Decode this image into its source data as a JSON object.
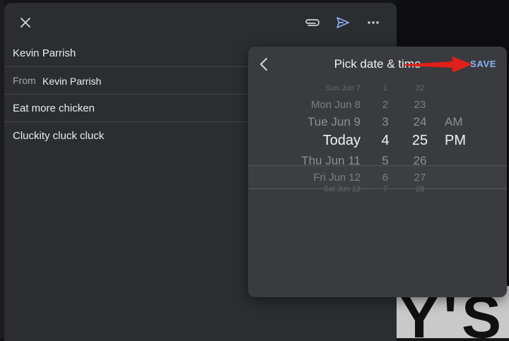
{
  "compose": {
    "to": "Kevin Parrish",
    "from_label": "From",
    "from_value": "Kevin Parrish",
    "subject": "Eat more chicken",
    "body": "Cluckity cluck cluck"
  },
  "picker": {
    "title": "Pick date & time",
    "save_label": "SAVE",
    "rows": [
      {
        "day": "Sun Jun 7",
        "hour": "1",
        "minute": "22",
        "ampm": ""
      },
      {
        "day": "Mon Jun 8",
        "hour": "2",
        "minute": "23",
        "ampm": ""
      },
      {
        "day": "Tue Jun 9",
        "hour": "3",
        "minute": "24",
        "ampm": "AM"
      },
      {
        "day": "Today",
        "hour": "4",
        "minute": "25",
        "ampm": "PM"
      },
      {
        "day": "Thu Jun 11",
        "hour": "5",
        "minute": "26",
        "ampm": ""
      },
      {
        "day": "Fri Jun 12",
        "hour": "6",
        "minute": "27",
        "ampm": ""
      },
      {
        "day": "Sat Jun 13",
        "hour": "7",
        "minute": "28",
        "ampm": ""
      }
    ]
  },
  "background": {
    "photo_text": "Y'S"
  },
  "colors": {
    "accent": "#8ab4f8",
    "arrow": "#e0201a",
    "sheet": "#2c2d30",
    "popover": "#3a3b3e"
  }
}
